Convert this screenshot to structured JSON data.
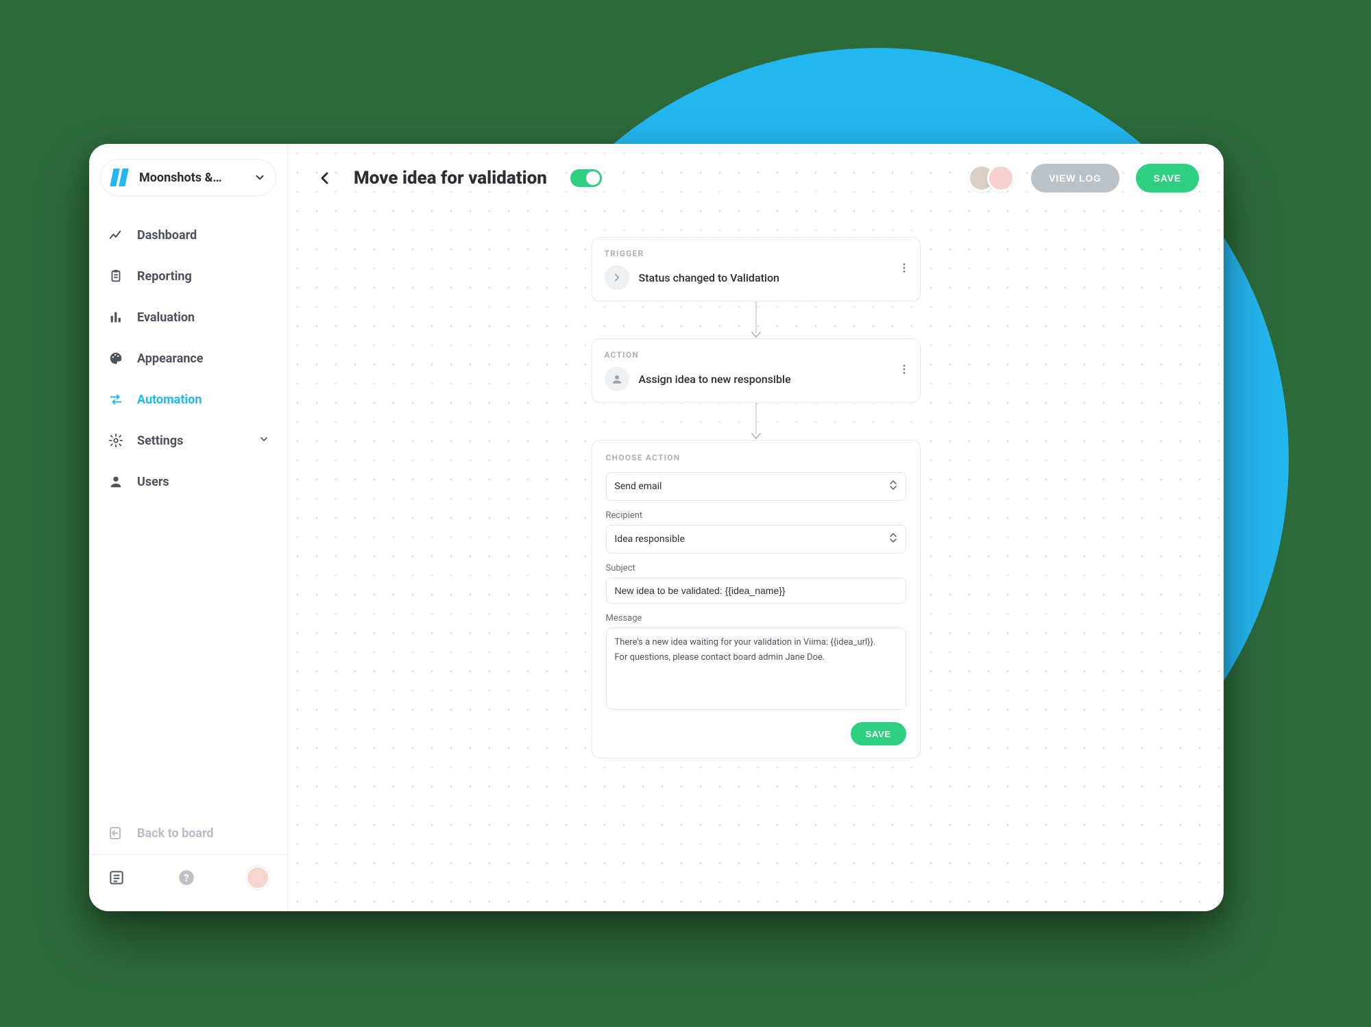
{
  "sidebar": {
    "project_name": "Moonshots &…",
    "items": [
      {
        "label": "Dashboard",
        "icon": "chart-line-icon",
        "active": false
      },
      {
        "label": "Reporting",
        "icon": "clipboard-icon",
        "active": false
      },
      {
        "label": "Evaluation",
        "icon": "bar-chart-icon",
        "active": false
      },
      {
        "label": "Appearance",
        "icon": "palette-icon",
        "active": false
      },
      {
        "label": "Automation",
        "icon": "swap-icon",
        "active": true
      },
      {
        "label": "Settings",
        "icon": "gear-icon",
        "active": false,
        "expandable": true
      },
      {
        "label": "Users",
        "icon": "user-icon",
        "active": false
      }
    ],
    "back_label": "Back to board"
  },
  "header": {
    "title": "Move idea for validation",
    "enabled_toggle": true,
    "view_log_label": "VIEW LOG",
    "save_label": "SAVE"
  },
  "flow": {
    "trigger": {
      "section_label": "TRIGGER",
      "text": "Status changed to Validation"
    },
    "action": {
      "section_label": "ACTION",
      "text": "Assign idea to new responsible"
    },
    "form": {
      "section_label": "CHOOSE ACTION",
      "action_select": "Send email",
      "recipient_label": "Recipient",
      "recipient_value": "Idea responsible",
      "subject_label": "Subject",
      "subject_value": "New idea to be validated: {{idea_name}}",
      "message_label": "Message",
      "message_value": "There's a new idea waiting for your validation in Viima: {{idea_url}}.\nFor questions, please contact board admin Jane Doe.",
      "save_label": "SAVE"
    }
  }
}
